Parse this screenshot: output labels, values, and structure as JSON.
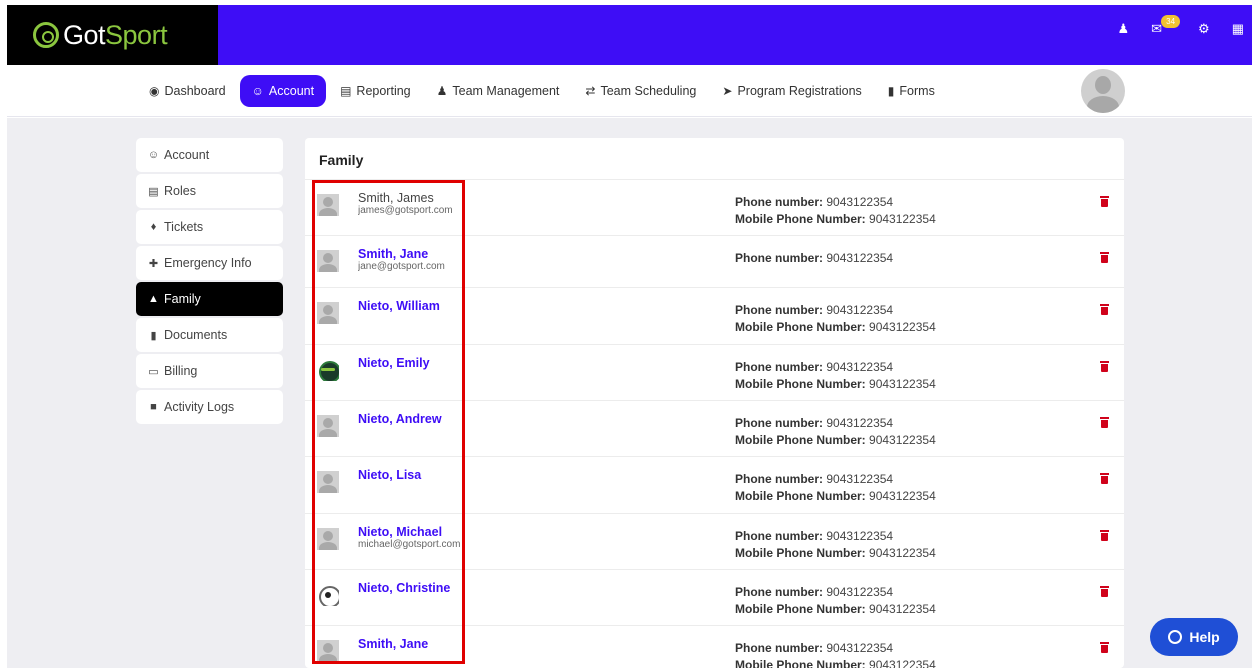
{
  "brand": {
    "logo_main": "Got",
    "logo_accent": "Sport"
  },
  "top_icons": {
    "messages_badge": "34"
  },
  "nav": {
    "items": [
      {
        "label": "Dashboard",
        "icon": "tachometer-icon"
      },
      {
        "label": "Account",
        "icon": "user-circle-icon",
        "active": true
      },
      {
        "label": "Reporting",
        "icon": "report-icon"
      },
      {
        "label": "Team Management",
        "icon": "users-icon"
      },
      {
        "label": "Team Scheduling",
        "icon": "exchange-icon"
      },
      {
        "label": "Program Registrations",
        "icon": "paper-plane-icon"
      },
      {
        "label": "Forms",
        "icon": "file-icon"
      }
    ]
  },
  "sidebar": {
    "items": [
      {
        "label": "Account",
        "icon": "user-circle-icon"
      },
      {
        "label": "Roles",
        "icon": "id-card-icon"
      },
      {
        "label": "Tickets",
        "icon": "ticket-icon"
      },
      {
        "label": "Emergency Info",
        "icon": "medical-icon"
      },
      {
        "label": "Family",
        "icon": "sitemap-icon",
        "active": true
      },
      {
        "label": "Documents",
        "icon": "folder-icon"
      },
      {
        "label": "Billing",
        "icon": "credit-card-icon"
      },
      {
        "label": "Activity Logs",
        "icon": "archive-icon"
      }
    ]
  },
  "panel": {
    "title": "Family",
    "phone_label": "Phone number:",
    "mobile_label": "Mobile Phone Number:",
    "members": [
      {
        "name": "Smith, James",
        "email": "james@gotsport.com",
        "phone": "9043122354",
        "mobile": "9043122354"
      },
      {
        "name": "Smith, Jane",
        "email": "jane@gotsport.com",
        "phone": "9043122354"
      },
      {
        "name": "Nieto, William",
        "phone": "9043122354",
        "mobile": "9043122354"
      },
      {
        "name": "Nieto, Emily",
        "phone": "9043122354",
        "mobile": "9043122354"
      },
      {
        "name": "Nieto, Andrew",
        "phone": "9043122354",
        "mobile": "9043122354"
      },
      {
        "name": "Nieto, Lisa",
        "phone": "9043122354",
        "mobile": "9043122354"
      },
      {
        "name": "Nieto, Michael",
        "email": "michael@gotsport.com",
        "phone": "9043122354",
        "mobile": "9043122354"
      },
      {
        "name": "Nieto, Christine",
        "phone": "9043122354",
        "mobile": "9043122354"
      },
      {
        "name": "Smith, Jane",
        "phone": "9043122354",
        "mobile": "9043122354"
      }
    ]
  },
  "help": {
    "label": "Help"
  },
  "colors": {
    "brand_purple": "#3e0df6",
    "accent_green": "#8bc63f",
    "delete_red": "#d0021b",
    "highlight_red": "#e00000"
  }
}
